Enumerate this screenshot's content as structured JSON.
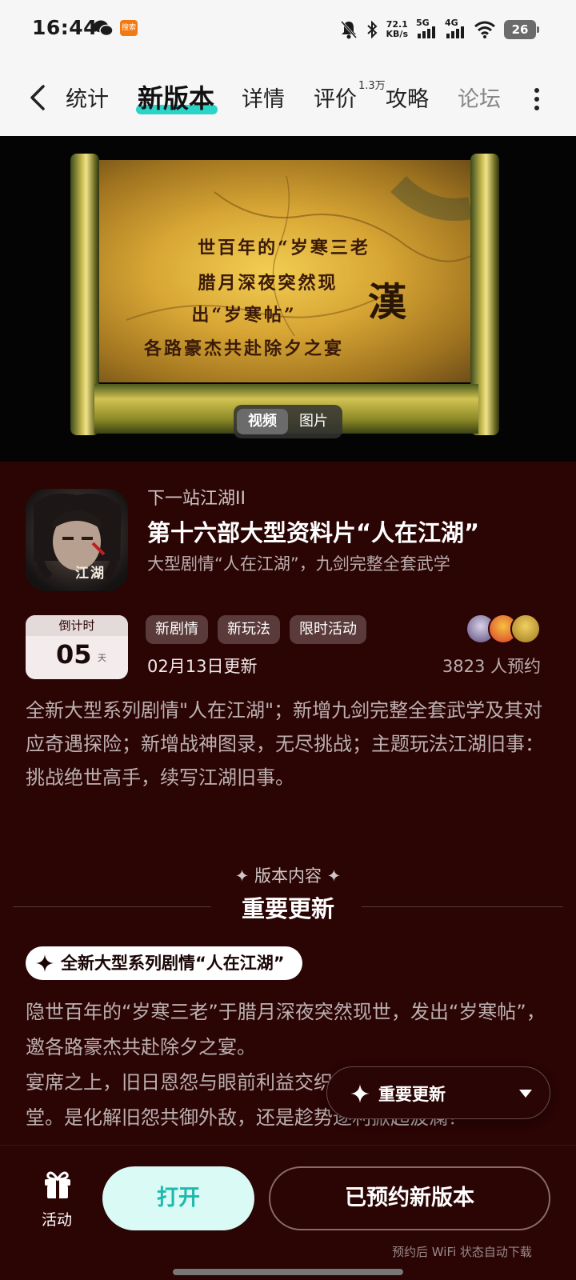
{
  "status_bar": {
    "time": "16:44",
    "app_badge": "搜索",
    "net_speed_value": "72.1",
    "net_speed_unit": "KB/s",
    "sim1": "5G",
    "sim2": "4G",
    "battery": "26"
  },
  "nav": {
    "tabs": [
      {
        "label": "统计"
      },
      {
        "label": "新版本"
      },
      {
        "label": "详情"
      },
      {
        "label": "评价"
      },
      {
        "label": "攻略"
      },
      {
        "label": "论坛"
      }
    ],
    "review_badge": "1.3万"
  },
  "banner": {
    "scroll_lines": [
      "世百年的“岁寒三老",
      "腊月深夜突然现",
      "出“岁寒帖”",
      "各路豪杰共赴除夕之宴"
    ],
    "han_char": "漢",
    "toggle": [
      "视频",
      "图片"
    ]
  },
  "app": {
    "icon_label": "江湖",
    "name": "下一站江湖II",
    "update_title": "第十六部大型资料片“人在江湖”",
    "update_subtitle": "大型剧情“人在江湖”，九剑完整全套武学"
  },
  "countdown": {
    "label": "倒计时",
    "number": "05",
    "unit": "天"
  },
  "tags": [
    "新剧情",
    "新玩法",
    "限时活动"
  ],
  "update_date": "02月13日更新",
  "reserve_count": "3823 人预约",
  "description": "全新大型系列剧情\"人在江湖\"；新增九剑完整全套武学及其对应奇遇探险；新增战神图录，无尽挑战；主题玩法江湖旧事：挑战绝世高手，续写江湖旧事。",
  "section": {
    "subtitle": "版本内容",
    "title": "重要更新"
  },
  "feature": {
    "pill": "全新大型系列剧情“人在江湖”",
    "body_line1": "隐世百年的“岁寒三老”于腊月深夜突然现世，发出“岁寒帖”，邀各路豪杰共赴除夕之宴。",
    "body_line2": "宴席之上，旧日恩怨与眼前利益交织，亦敌亦友的势力齐聚一堂。是化解旧怨共御外敌，还是趁势逐利掀起波澜？"
  },
  "floating_menu": {
    "label": "重要更新"
  },
  "bottom": {
    "activity_label": "活动",
    "open_label": "打开",
    "reserved_label": "已预约新版本",
    "wifi_note": "预约后 WiFi 状态自动下载"
  },
  "colors": {
    "accent": "#2ad4c8",
    "background": "#2b0404",
    "open_button_bg": "#d9faf5",
    "open_button_text": "#1fb9ad"
  }
}
